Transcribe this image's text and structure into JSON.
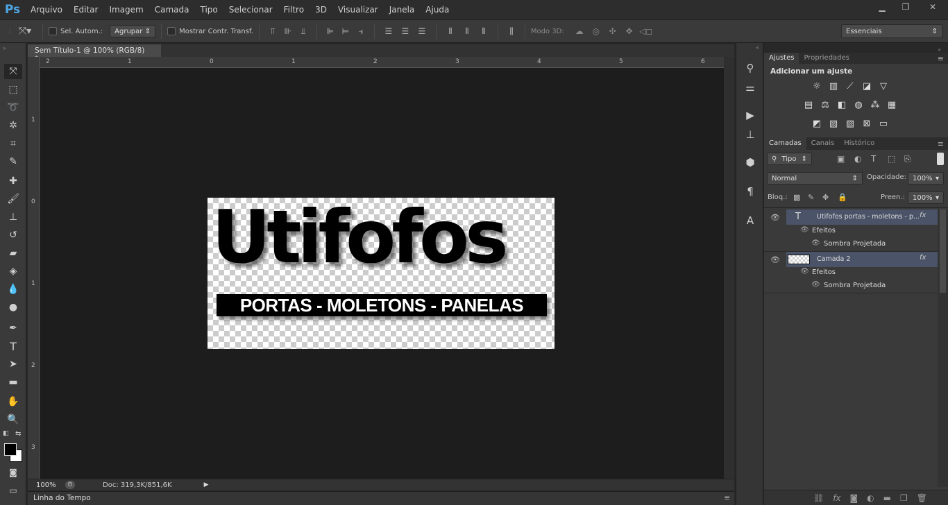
{
  "app": {
    "logo": "Ps",
    "menu": [
      "Arquivo",
      "Editar",
      "Imagem",
      "Camada",
      "Tipo",
      "Selecionar",
      "Filtro",
      "3D",
      "Visualizar",
      "Janela",
      "Ajuda"
    ],
    "win_min": "▁",
    "win_max": "❐",
    "win_close": "✕"
  },
  "options": {
    "auto_select_label": "Sel. Autom.:",
    "auto_select_value": "Agrupar",
    "show_transform_label": "Mostrar Contr. Transf.",
    "mode3d_label": "Modo 3D:",
    "workspace": "Essenciais"
  },
  "document": {
    "tab_title": "Sem Título-1 @ 100% (RGB/8) *",
    "close": "×",
    "logo_text": "Utifofos",
    "tagline": "PORTAS - MOLETONS - PANELAS"
  },
  "ruler": {
    "h_labels": [
      "2",
      "1",
      "0",
      "1",
      "2",
      "3",
      "4",
      "5",
      "6"
    ],
    "v_labels": [
      "1",
      "0",
      "1",
      "2",
      "3"
    ]
  },
  "status": {
    "zoom": "100%",
    "doc_info": "Doc: 319,3K/851,6K"
  },
  "timeline": {
    "label": "Linha do Tempo"
  },
  "adjust_panel": {
    "tabs": [
      "Ajustes",
      "Propriedades"
    ],
    "heading": "Adicionar um ajuste"
  },
  "layers_panel": {
    "tabs": [
      "Camadas",
      "Canais",
      "Histórico"
    ],
    "filter": "Tipo",
    "blend_mode": "Normal",
    "opacity_label": "Opacidade:",
    "opacity_value": "100%",
    "lock_label": "Bloq.:",
    "fill_label": "Preen.:",
    "fill_value": "100%",
    "layers": [
      {
        "name": "Utifofos portas - moletons - p...",
        "effects_label": "Efeitos",
        "effect": "Sombra Projetada"
      },
      {
        "name": "Camada 2",
        "effects_label": "Efeitos",
        "effect": "Sombra Projetada"
      }
    ]
  },
  "colors": {
    "accent": "#4ea9e8",
    "selected_layer": "#4a5368"
  }
}
